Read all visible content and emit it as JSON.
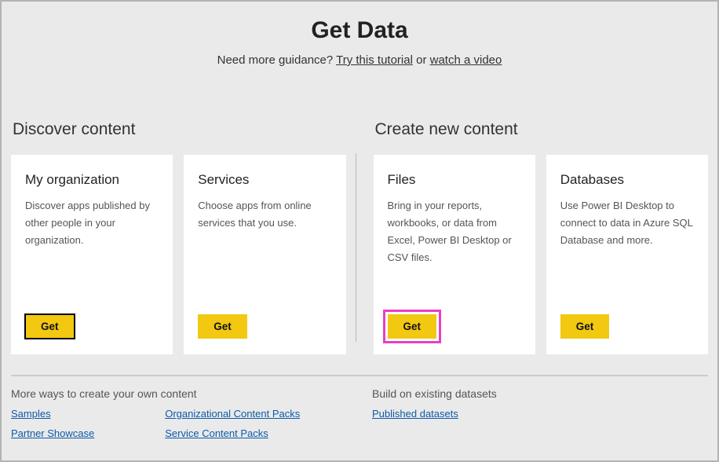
{
  "header": {
    "title": "Get Data",
    "subtitle_prefix": "Need more guidance? ",
    "tutorial_link": "Try this tutorial",
    "subtitle_middle": " or ",
    "video_link": "watch a video"
  },
  "sections": {
    "discover": {
      "heading": "Discover content",
      "cards": [
        {
          "title": "My organization",
          "desc": "Discover apps published by other people in your organization.",
          "button": "Get"
        },
        {
          "title": "Services",
          "desc": "Choose apps from online services that you use.",
          "button": "Get"
        }
      ]
    },
    "create": {
      "heading": "Create new content",
      "cards": [
        {
          "title": "Files",
          "desc": "Bring in your reports, workbooks, or data from Excel, Power BI Desktop or CSV files.",
          "button": "Get"
        },
        {
          "title": "Databases",
          "desc": "Use Power BI Desktop to connect to data in Azure SQL Database and more.",
          "button": "Get"
        }
      ]
    }
  },
  "footer": {
    "left": {
      "heading": "More ways to create your own content",
      "col1": [
        "Samples",
        "Partner Showcase"
      ],
      "col2": [
        "Organizational Content Packs",
        "Service Content Packs"
      ]
    },
    "right": {
      "heading": "Build on existing datasets",
      "links": [
        "Published datasets"
      ]
    }
  }
}
